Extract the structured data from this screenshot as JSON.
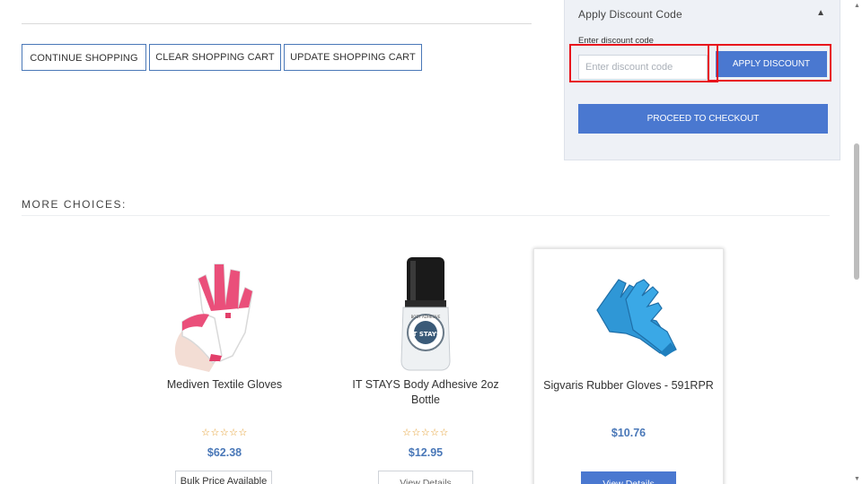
{
  "cart_actions": {
    "continue_label": "CONTINUE SHOPPING",
    "clear_label": "CLEAR SHOPPING CART",
    "update_label": "UPDATE SHOPPING CART"
  },
  "discount": {
    "title": "Apply Discount Code",
    "field_label": "Enter discount code",
    "placeholder": "Enter discount code",
    "value": "",
    "apply_label": "APPLY DISCOUNT",
    "checkout_label": "PROCEED TO CHECKOUT",
    "expanded": true
  },
  "more_choices": {
    "title": "MORE CHOICES:",
    "products": [
      {
        "name": "Mediven Textile Gloves",
        "rating": "☆☆☆☆☆",
        "price": "$62.38",
        "action_label": "Bulk Price Available",
        "image_icon": "textile-glove-icon"
      },
      {
        "name": "IT STAYS Body Adhesive 2oz Bottle",
        "rating": "☆☆☆☆☆",
        "price": "$12.95",
        "action_label": "View Details",
        "image_icon": "adhesive-bottle-icon",
        "bottle_label": "IT STAYS",
        "bottle_ring_text": "BODY ADHESIVE"
      },
      {
        "name": "Sigvaris Rubber Gloves - 591RPR",
        "rating": "",
        "price": "$10.76",
        "action_label": "View Details",
        "image_icon": "rubber-glove-icon"
      }
    ]
  },
  "colors": {
    "accent": "#4a78d0",
    "price": "#4a78b8",
    "highlight": "#e8141c",
    "star": "#e39b2a",
    "panel_bg": "#eef1f6"
  }
}
